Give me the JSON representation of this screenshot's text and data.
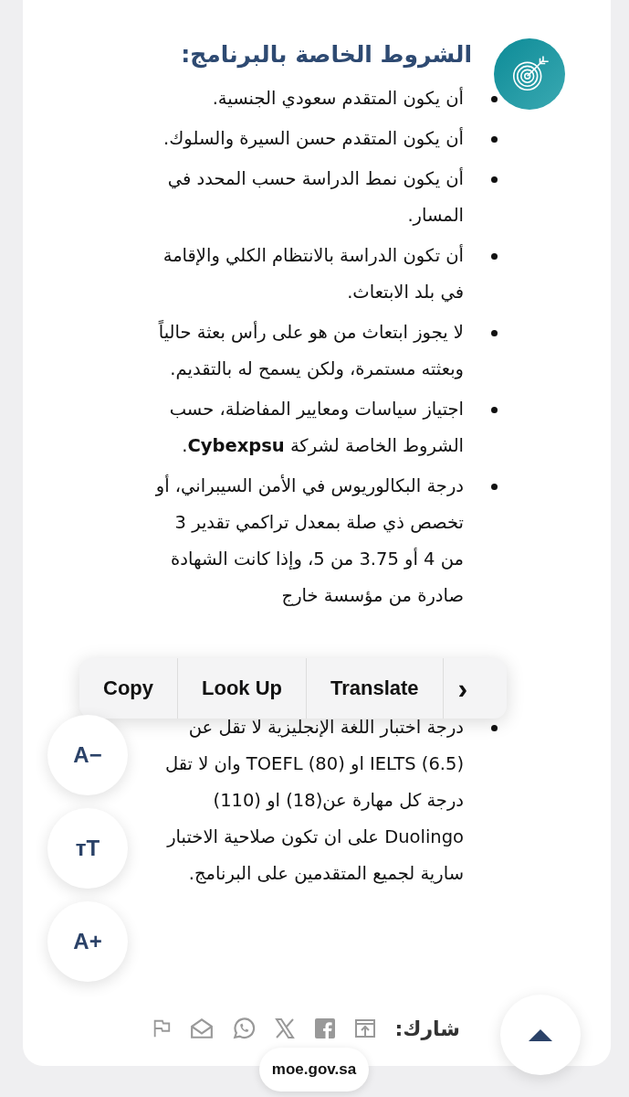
{
  "section": {
    "title": "الشروط الخاصة بالبرنامج:",
    "items": [
      "أن يكون المتقدم سعودي الجنسية.",
      "أن يكون المتقدم حسن السيرة والسلوك.",
      "أن يكون نمط الدراسة حسب المحدد في المسار.",
      "أن تكون الدراسة بالانتظام الكلي والإقامة في بلد الابتعاث.",
      "لا يجوز ابتعاث من هو على رأس بعثة حالياً وبعثته مستمرة، ولكن يسمح له بالتقديم.",
      "اجتياز سياسات ومعايير المفاضلة، حسب الشروط الخاصة لشركة **Cybexpsu**.",
      "درجة البكالوريوس في الأمن السيبراني، أو تخصص ذي صلة بمعدل تراكمي تقدير 3 من 4 أو 3.75 من 5، وإذا كانت الشهادة صادرة من مؤسسة خارج",
      "درجة اختبار اللغة الإنجليزية لا تقل عن (6.5) IELTS او (80) TOEFL وان لا تقل درجة كل مهارة عن(18) او (110) Duolingo على ان تكون صلاحية الاختبار سارية لجميع المتقدمين على البرنامج."
    ]
  },
  "context_menu": {
    "copy": "Copy",
    "look_up": "Look Up",
    "translate": "Translate",
    "more": "›"
  },
  "font_controls": [
    "A−",
    "ᴛT",
    "A+"
  ],
  "share": {
    "label": "شارك:"
  },
  "url_pill": "moe.gov.sa"
}
